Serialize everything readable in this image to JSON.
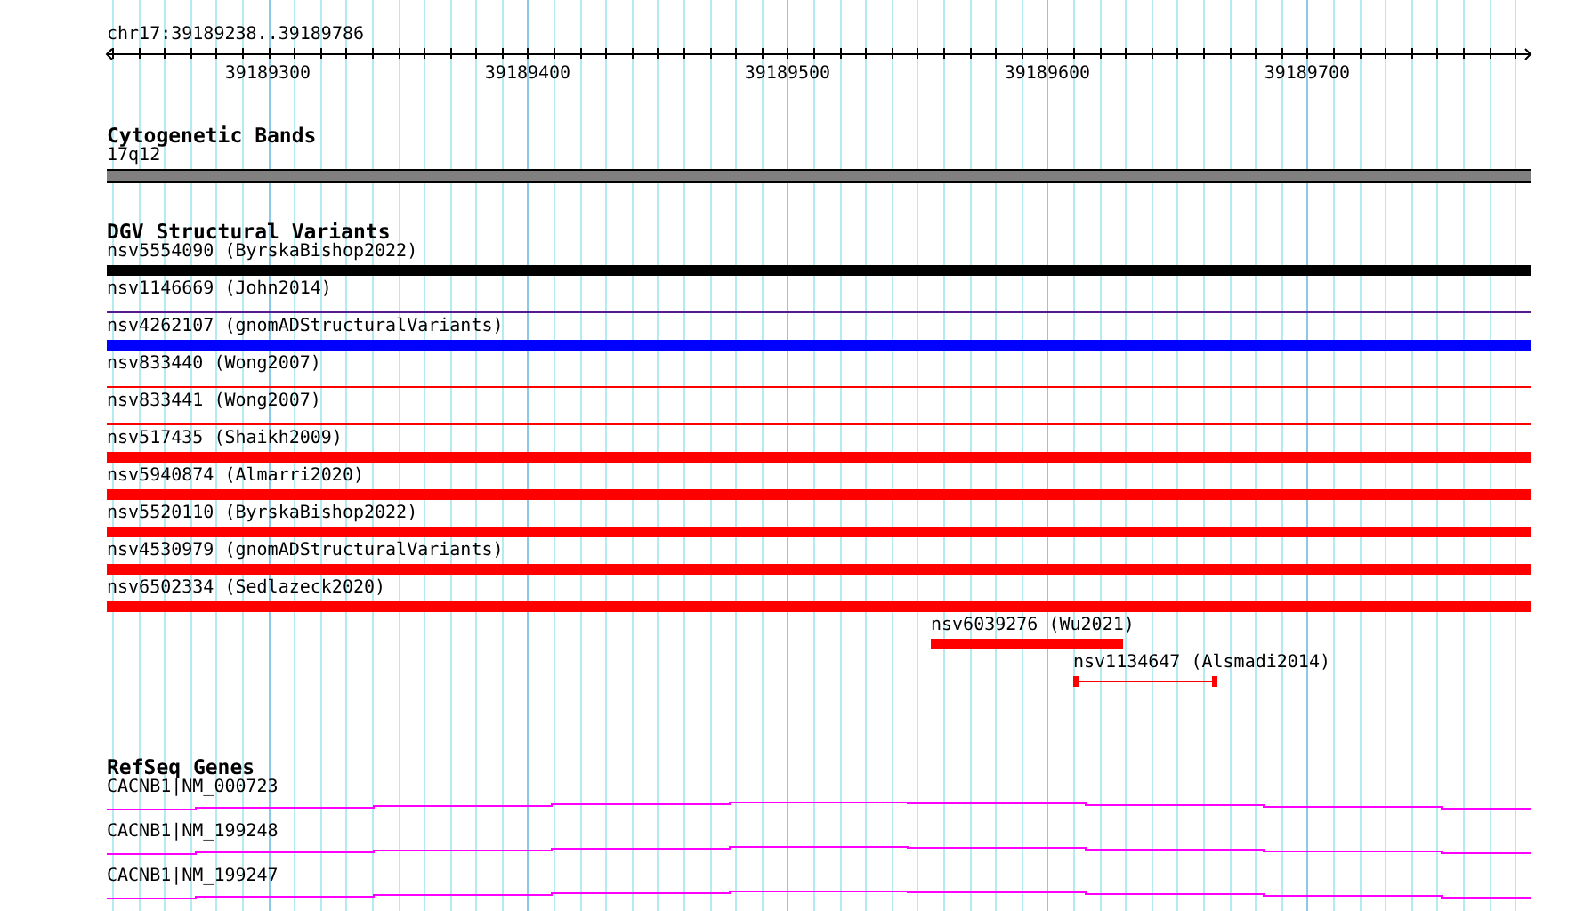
{
  "location": {
    "prefix": "chr17:",
    "start": "39189238",
    "separator": "..",
    "end": "39189786"
  },
  "axis": {
    "ticks": [
      "39189300",
      "39189400",
      "39189500",
      "39189600",
      "39189700"
    ]
  },
  "tracks": [
    {
      "kind": "cytoband",
      "title": "Cytogenetic Bands",
      "features": [
        {
          "name": "17q12",
          "kind": "band",
          "color": "#808080"
        }
      ]
    },
    {
      "kind": "variants",
      "title": "DGV Structural Variants",
      "features": [
        {
          "name": "nsv5554090 (ByrskaBishop2022)",
          "kind": "bar",
          "color": "#000000"
        },
        {
          "name": "nsv1146669 (John2014)",
          "kind": "line",
          "color": "#551a8b"
        },
        {
          "name": "nsv4262107 (gnomADStructuralVariants)",
          "kind": "bar",
          "color": "#0000ff"
        },
        {
          "name": "nsv833440 (Wong2007)",
          "kind": "line",
          "color": "#ff0000"
        },
        {
          "name": "nsv833441 (Wong2007)",
          "kind": "line",
          "color": "#ff0000"
        },
        {
          "name": "nsv517435 (Shaikh2009)",
          "kind": "bar",
          "color": "#ff0000"
        },
        {
          "name": "nsv5940874 (Almarri2020)",
          "kind": "bar",
          "color": "#ff0000"
        },
        {
          "name": "nsv5520110 (ByrskaBishop2022)",
          "kind": "bar",
          "color": "#ff0000"
        },
        {
          "name": "nsv4530979 (gnomADStructuralVariants)",
          "kind": "bar",
          "color": "#ff0000"
        },
        {
          "name": "nsv6502334 (Sedlazeck2020)",
          "kind": "bar",
          "color": "#ff0000"
        },
        {
          "name": "nsv6039276 (Wu2021)",
          "kind": "bar",
          "color": "#ff0000"
        },
        {
          "name": "nsv1134647 (Alsmadi2014)",
          "kind": "span",
          "color": "#ff0000"
        }
      ]
    },
    {
      "kind": "genes",
      "title": "RefSeq Genes",
      "features": [
        {
          "name": "CACNB1|NM_000723",
          "kind": "gene",
          "color": "#ff00ff"
        },
        {
          "name": "CACNB1|NM_199248",
          "kind": "gene",
          "color": "#ff00ff"
        },
        {
          "name": "CACNB1|NM_199247",
          "kind": "gene",
          "color": "#ff00ff"
        }
      ]
    }
  ]
}
